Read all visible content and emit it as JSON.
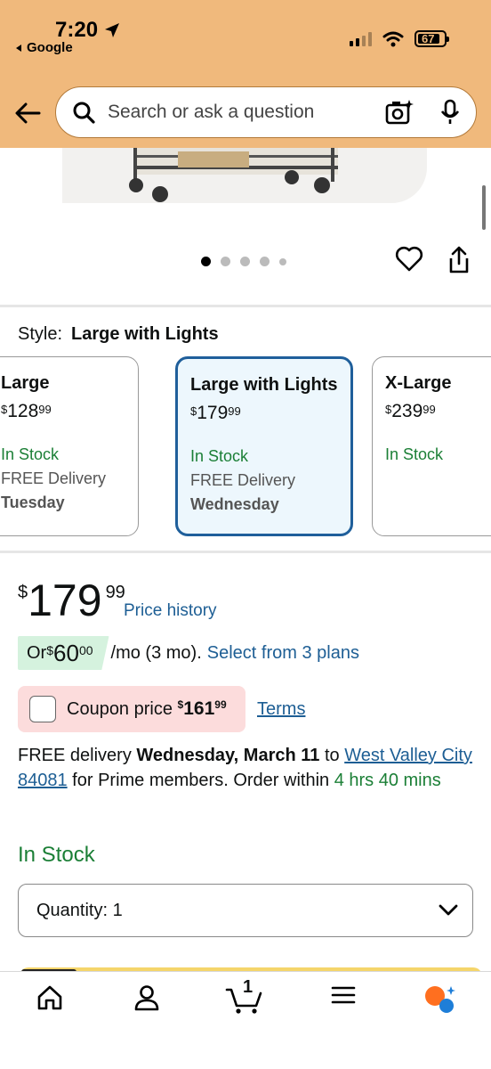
{
  "status_bar": {
    "time": "7:20",
    "back_app": "Google",
    "battery": "67"
  },
  "search": {
    "placeholder": "Search or ask a question"
  },
  "gallery": {
    "total_dots": 5,
    "active_index": 0
  },
  "style": {
    "label": "Style:",
    "selected": "Large with Lights",
    "variants": [
      {
        "name": "Large",
        "currency": "$",
        "price_whole": "128",
        "price_frac": "99",
        "stock": "In Stock",
        "delivery": "FREE Delivery",
        "day": "Tuesday"
      },
      {
        "name": "Large with Lights",
        "currency": "$",
        "price_whole": "179",
        "price_frac": "99",
        "stock": "In Stock",
        "delivery": "FREE Delivery",
        "day": "Wednesday"
      },
      {
        "name": "X-Large",
        "currency": "$",
        "price_whole": "239",
        "price_frac": "99",
        "stock": "In Stock",
        "delivery": "",
        "day": ""
      }
    ]
  },
  "price": {
    "currency": "$",
    "whole": "179",
    "frac": "99",
    "history_link": "Price history"
  },
  "plan": {
    "prefix": "Or ",
    "currency": "$",
    "amount": "60",
    "cents": "00",
    "suffix": "/mo (3 mo).",
    "link": "Select from 3 plans"
  },
  "coupon": {
    "label": "Coupon price ",
    "currency": "$",
    "whole": "161",
    "frac": "99",
    "terms": "Terms"
  },
  "delivery": {
    "prefix": "FREE delivery ",
    "date": "Wednesday, March 11",
    "to": " to ",
    "location": "West Valley City 84081",
    "middle": " for Prime members. Order within ",
    "countdown": "4 hrs 40 mins"
  },
  "stock_status": "In Stock",
  "quantity": {
    "label": "Quantity:",
    "value": "1"
  },
  "nav": {
    "cart_count": "1",
    "items": [
      "home-icon",
      "account-icon",
      "cart-icon",
      "menu-icon",
      "rufus-icon"
    ]
  },
  "colors": {
    "header_bg": "#f0b97c",
    "link": "#1d5e94",
    "in_stock": "#1b7f36",
    "selected_border": "#1f5f9b",
    "coupon_bg": "#fcdcdc",
    "plan_bg": "#d5f2de"
  }
}
